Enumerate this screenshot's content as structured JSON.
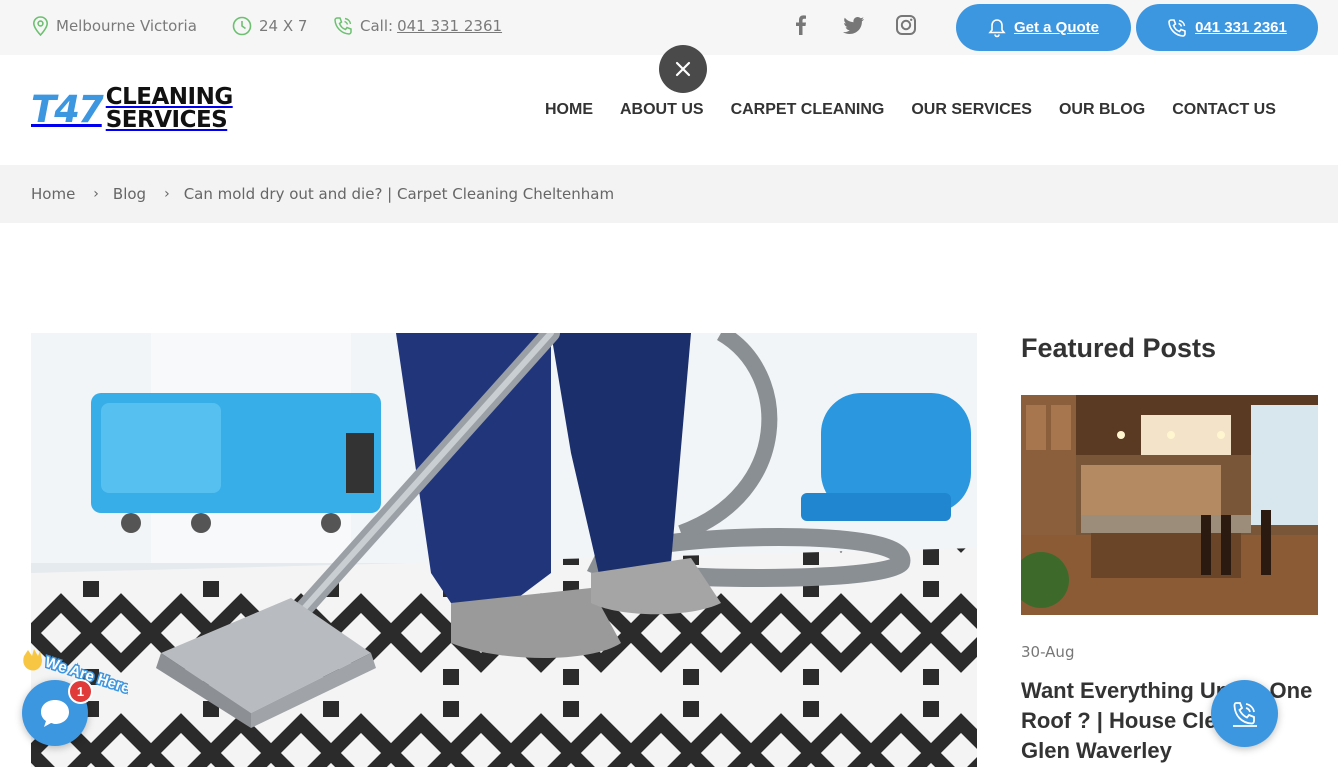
{
  "topbar": {
    "location": "Melbourne Victoria",
    "hours": "24 X 7",
    "call_prefix": "Call:",
    "call_number": "041 331 2361",
    "quote_button": "Get a Quote",
    "phone_button": "041 331 2361"
  },
  "social": [
    "facebook-icon",
    "twitter-icon",
    "instagram-icon"
  ],
  "logo": {
    "mark": "T47",
    "line1": "CLEANING",
    "line2": "SERVICES"
  },
  "nav": {
    "items": [
      "HOME",
      "ABOUT US",
      "CARPET CLEANING",
      "OUR SERVICES",
      "OUR BLOG",
      "CONTACT US"
    ]
  },
  "breadcrumb": {
    "home": "Home",
    "blog": "Blog",
    "current": "Can mold dry out and die? | Carpet Cleaning Cheltenham"
  },
  "sidebar": {
    "title": "Featured Posts",
    "post_date": "30-Aug",
    "post_title": "Want Everything Under One Roof ? | House Cleaning Glen Waverley"
  },
  "chat": {
    "badge_count": "1",
    "bubble_text": "We Are Here!"
  },
  "colors": {
    "accent": "#3d96e0",
    "topbar_bg": "#f6f6f6",
    "icon_green": "#6cc070"
  }
}
